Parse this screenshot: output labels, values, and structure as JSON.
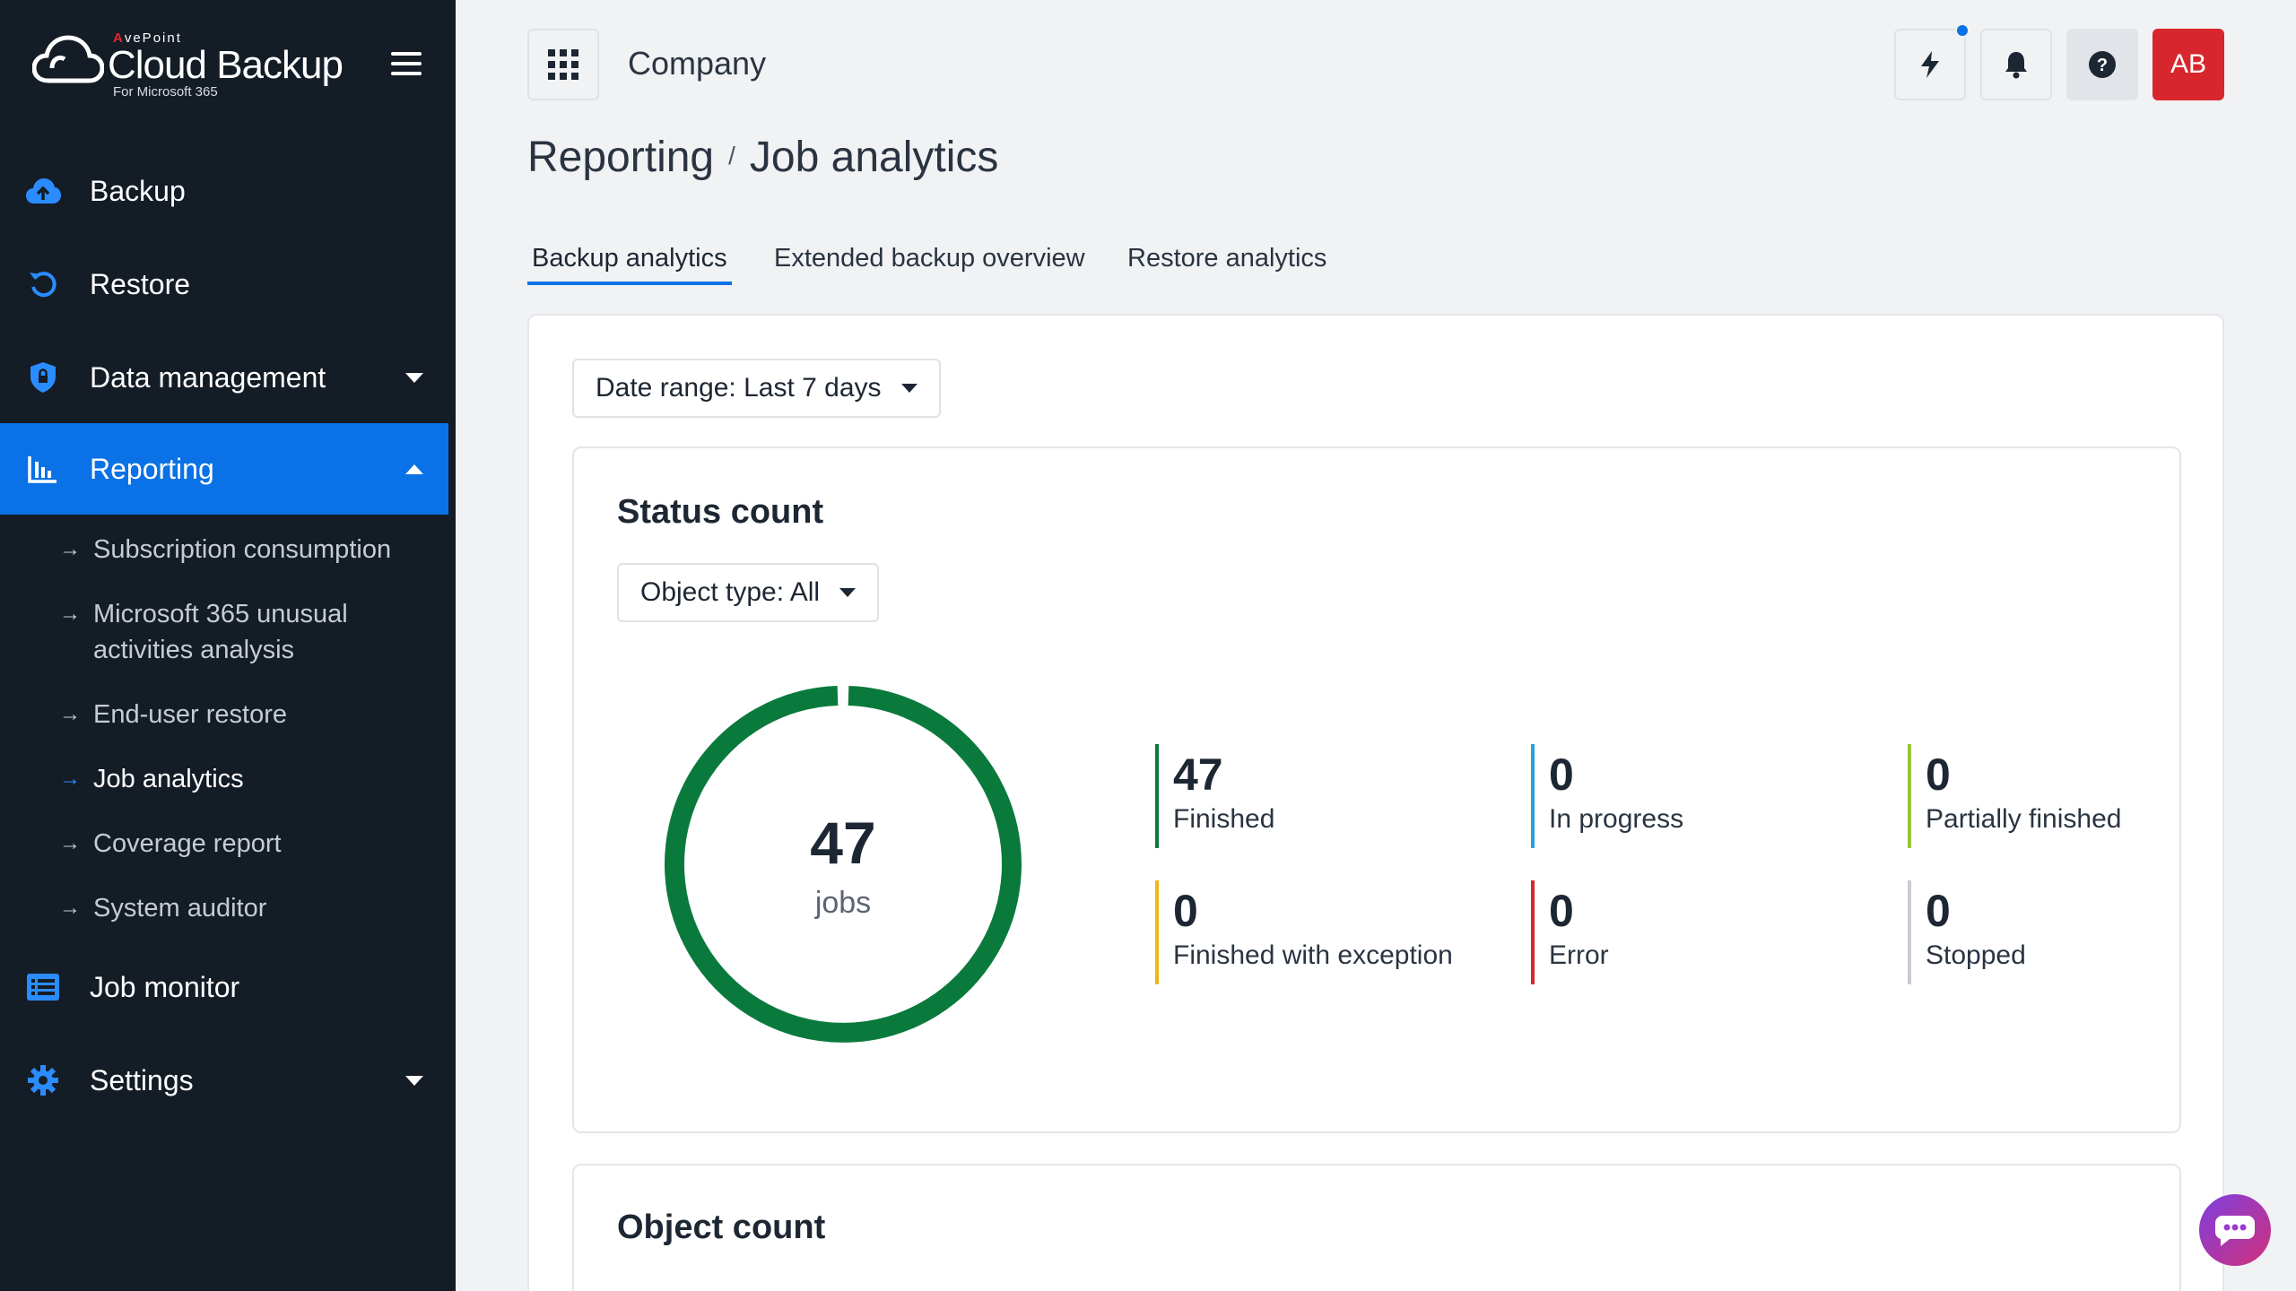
{
  "sidebar": {
    "logo": {
      "brand_prefix": "A",
      "brand": "vePoint",
      "product": "Cloud Backup",
      "sub": "For Microsoft 365"
    },
    "items": [
      {
        "label": "Backup",
        "icon": "cloud-upload-icon"
      },
      {
        "label": "Restore",
        "icon": "restore-icon"
      },
      {
        "label": "Data management",
        "icon": "shield-lock-icon"
      },
      {
        "label": "Reporting",
        "icon": "bar-chart-icon"
      },
      {
        "label": "Job monitor",
        "icon": "list-icon"
      },
      {
        "label": "Settings",
        "icon": "gear-icon"
      }
    ],
    "sub_items": [
      {
        "label": "Subscription consumption"
      },
      {
        "label": "Microsoft 365 unusual activities analysis"
      },
      {
        "label": "End-user restore"
      },
      {
        "label": "Job analytics"
      },
      {
        "label": "Coverage report"
      },
      {
        "label": "System auditor"
      }
    ],
    "accent": "#0a72e6",
    "background": "#141c26"
  },
  "header": {
    "company": "Company",
    "avatar": "AB",
    "icons": [
      "apps-grid-icon",
      "lightning-icon",
      "bell-icon",
      "help-icon"
    ]
  },
  "breadcrumb": {
    "parent": "Reporting",
    "separator": "/",
    "current": "Job analytics"
  },
  "tabs": [
    {
      "label": "Backup analytics"
    },
    {
      "label": "Extended backup overview"
    },
    {
      "label": "Restore analytics"
    }
  ],
  "filters": {
    "date_range": "Date range: Last 7 days",
    "object_type": "Object type: All"
  },
  "status_count": {
    "title": "Status count",
    "total": "47",
    "total_label": "jobs",
    "stats": [
      {
        "value": "47",
        "label": "Finished",
        "color": "#0a7a3c"
      },
      {
        "value": "0",
        "label": "In progress",
        "color": "#2b9fe0"
      },
      {
        "value": "0",
        "label": "Partially finished",
        "color": "#9cc43b"
      },
      {
        "value": "0",
        "label": "Finished with exception",
        "color": "#f2b31b"
      },
      {
        "value": "0",
        "label": "Error",
        "color": "#d8262d"
      },
      {
        "value": "0",
        "label": "Stopped",
        "color": "#c8cdd3"
      }
    ],
    "donut_color": "#0a7a3c"
  },
  "object_count": {
    "title": "Object count"
  }
}
